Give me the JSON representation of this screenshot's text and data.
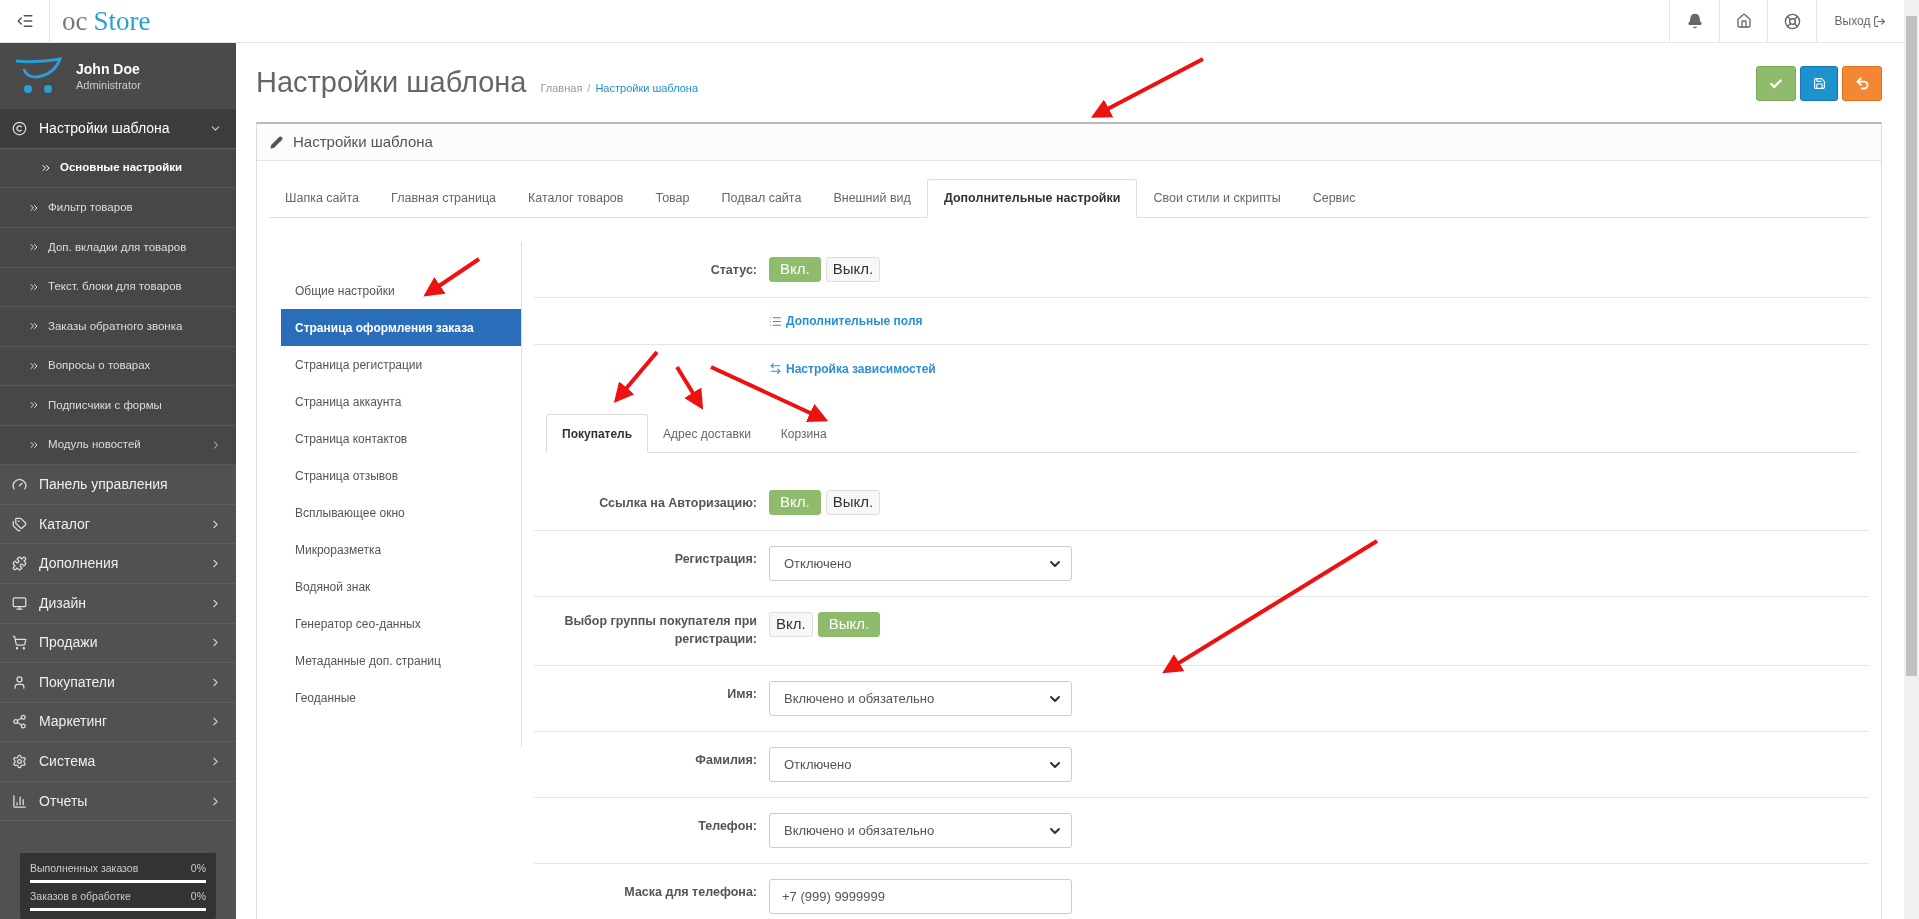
{
  "header": {
    "logo_prefix": "oc",
    "logo_main": "Store",
    "logout": "Выход"
  },
  "user": {
    "name": "John Doe",
    "role": "Administrator"
  },
  "sidebar": {
    "items": [
      {
        "label": "Настройки шаблона",
        "has_arrow": true,
        "expanded": true,
        "children": [
          {
            "label": "Основные настройки",
            "selected": true,
            "has_arrow": false
          },
          {
            "label": "Фильтр товаров",
            "selected": false,
            "has_arrow": false
          },
          {
            "label": "Доп. вкладки для товаров",
            "selected": false,
            "has_arrow": false
          },
          {
            "label": "Текст. блоки для товаров",
            "selected": false,
            "has_arrow": false
          },
          {
            "label": "Заказы обратного звонка",
            "selected": false,
            "has_arrow": false
          },
          {
            "label": "Вопросы о товарах",
            "selected": false,
            "has_arrow": false
          },
          {
            "label": "Подписчики с формы",
            "selected": false,
            "has_arrow": false
          },
          {
            "label": "Модуль новостей",
            "selected": false,
            "has_arrow": true
          }
        ]
      },
      {
        "label": "Панель управления",
        "has_arrow": false,
        "expanded": false
      },
      {
        "label": "Каталог",
        "has_arrow": true,
        "expanded": false
      },
      {
        "label": "Дополнения",
        "has_arrow": true,
        "expanded": false
      },
      {
        "label": "Дизайн",
        "has_arrow": true,
        "expanded": false
      },
      {
        "label": "Продажи",
        "has_arrow": true,
        "expanded": false
      },
      {
        "label": "Покупатели",
        "has_arrow": true,
        "expanded": false
      },
      {
        "label": "Маркетинг",
        "has_arrow": true,
        "expanded": false
      },
      {
        "label": "Система",
        "has_arrow": true,
        "expanded": false
      },
      {
        "label": "Отчеты",
        "has_arrow": true,
        "expanded": false
      }
    ],
    "stats": [
      {
        "label": "Выполненных заказов",
        "value": "0%",
        "level": 0
      },
      {
        "label": "Заказов в обработке",
        "value": "0%",
        "level": 0
      }
    ]
  },
  "page": {
    "title": "Настройки шаблона",
    "separator": "/",
    "breadcrumbs": [
      {
        "label": "Главная",
        "selected": false
      },
      {
        "label": "Настройки шаблона",
        "selected": true
      }
    ]
  },
  "panel": {
    "title": "Настройки шаблона",
    "tabs": [
      {
        "label": "Шапка сайта",
        "selected": false
      },
      {
        "label": "Главная страница",
        "selected": false
      },
      {
        "label": "Каталог товаров",
        "selected": false
      },
      {
        "label": "Товар",
        "selected": false
      },
      {
        "label": "Подвал сайта",
        "selected": false
      },
      {
        "label": "Внешний вид",
        "selected": false
      },
      {
        "label": "Дополнительные настройки",
        "selected": true
      },
      {
        "label": "Свои стили и скрипты",
        "selected": false
      },
      {
        "label": "Сервис",
        "selected": false
      }
    ],
    "subnav": [
      {
        "label": "Общие настройки",
        "selected": false
      },
      {
        "label": "Страница оформления заказа",
        "selected": true
      },
      {
        "label": "Страница регистрации",
        "selected": false
      },
      {
        "label": "Страница аккаунта",
        "selected": false
      },
      {
        "label": "Страница контактов",
        "selected": false
      },
      {
        "label": "Страница отзывов",
        "selected": false
      },
      {
        "label": "Всплывающее окно",
        "selected": false
      },
      {
        "label": "Микроразметка",
        "selected": false
      },
      {
        "label": "Водяной знак",
        "selected": false
      },
      {
        "label": "Генератор сео-данных",
        "selected": false
      },
      {
        "label": "Метаданные доп. страниц",
        "selected": false
      },
      {
        "label": "Геоданные",
        "selected": false
      }
    ],
    "rows": [
      {
        "kind": "toggle",
        "label": "Статус:",
        "options": [
          {
            "label": "Вкл.",
            "selected": true
          },
          {
            "label": "Выкл.",
            "selected": false
          }
        ]
      },
      {
        "kind": "link",
        "label": "Дополнительные поля"
      },
      {
        "kind": "link",
        "label": "Настройка зависимостей"
      }
    ],
    "subtabs": [
      {
        "label": "Покупатель",
        "selected": true
      },
      {
        "label": "Адрес доставки",
        "selected": false
      },
      {
        "label": "Корзина",
        "selected": false
      }
    ],
    "fields": [
      {
        "kind": "toggle",
        "label": "Ссылка на Авторизацию:",
        "options": [
          {
            "label": "Вкл.",
            "selected": true
          },
          {
            "label": "Выкл.",
            "selected": false
          }
        ]
      },
      {
        "kind": "select",
        "label": "Регистрация:",
        "value": "Отключено"
      },
      {
        "kind": "toggle",
        "label": "Выбор группы покупателя при регистрации:",
        "options": [
          {
            "label": "Вкл.",
            "selected": false
          },
          {
            "label": "Выкл.",
            "selected": true
          }
        ]
      },
      {
        "kind": "select",
        "label": "Имя:",
        "value": "Включено и обязательно"
      },
      {
        "kind": "select",
        "label": "Фамилия:",
        "value": "Отключено"
      },
      {
        "kind": "select",
        "label": "Телефон:",
        "value": "Включено и обязательно"
      },
      {
        "kind": "input",
        "label": "Маска для телефона:",
        "value": "+7 (999) 9999999"
      }
    ]
  }
}
